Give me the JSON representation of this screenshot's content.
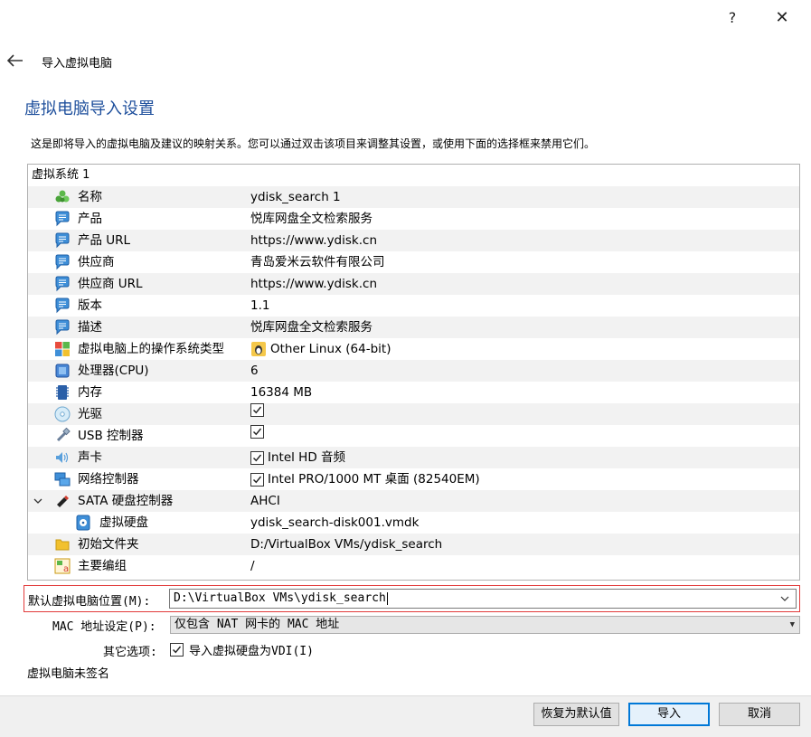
{
  "window": {
    "help": "?",
    "close": "✕"
  },
  "wizard": {
    "title": "导入虚拟电脑",
    "heading": "虚拟电脑导入设置",
    "description": "这是即将导入的虚拟电脑及建议的映射关系。您可以通过双击该项目来调整其设置，或使用下面的选择框来禁用它们。"
  },
  "tree": {
    "root": "虚拟系统 1",
    "rows": [
      {
        "label": "名称",
        "value": "ydisk_search 1",
        "icon": "name-puzzle-icon"
      },
      {
        "label": "产品",
        "value": "悦库网盘全文检索服务",
        "icon": "description-bubble-icon"
      },
      {
        "label": "产品 URL",
        "value": "https://www.ydisk.cn",
        "icon": "description-bubble-icon"
      },
      {
        "label": "供应商",
        "value": "青岛爱米云软件有限公司",
        "icon": "description-bubble-icon"
      },
      {
        "label": "供应商 URL",
        "value": "https://www.ydisk.cn",
        "icon": "description-bubble-icon"
      },
      {
        "label": "版本",
        "value": "1.1",
        "icon": "description-bubble-icon"
      },
      {
        "label": "描述",
        "value": "悦库网盘全文检索服务",
        "icon": "description-bubble-icon"
      },
      {
        "label": "虚拟电脑上的操作系统类型",
        "value": "Other Linux (64-bit)",
        "icon": "os-type-icon"
      },
      {
        "label": "处理器(CPU)",
        "value": "6",
        "icon": "cpu-icon"
      },
      {
        "label": "内存",
        "value": "16384 MB",
        "icon": "ram-icon"
      },
      {
        "label": "光驱",
        "value": "",
        "icon": "optical-drive-icon",
        "checked": true
      },
      {
        "label": "USB 控制器",
        "value": "",
        "icon": "usb-icon",
        "checked": true
      },
      {
        "label": "声卡",
        "value": "Intel HD 音频",
        "icon": "sound-card-icon",
        "checked": true
      },
      {
        "label": "网络控制器",
        "value": "Intel PRO/1000 MT 桌面 (82540EM)",
        "icon": "network-icon",
        "checked": true
      },
      {
        "label": "SATA 硬盘控制器",
        "value": "AHCI",
        "icon": "sata-controller-icon"
      },
      {
        "label": "虚拟硬盘",
        "value": "ydisk_search-disk001.vmdk",
        "icon": "virtual-disk-icon"
      },
      {
        "label": "初始文件夹",
        "value": "D:/VirtualBox VMs/ydisk_search",
        "icon": "folder-icon"
      },
      {
        "label": "主要编组",
        "value": "/",
        "icon": "group-icon"
      }
    ]
  },
  "form": {
    "location_label": "默认虚拟电脑位置(M):",
    "location_value": "D:\\VirtualBox VMs\\ydisk_search",
    "mac_label": "MAC 地址设定(P):",
    "mac_value": "仅包含 NAT 网卡的 MAC 地址",
    "other_label": "其它选项:",
    "other_option": "导入虚拟硬盘为VDI(I)",
    "unsigned_note": "虚拟电脑未签名"
  },
  "buttons": {
    "restore": "恢复为默认值",
    "import": "导入",
    "cancel": "取消"
  }
}
